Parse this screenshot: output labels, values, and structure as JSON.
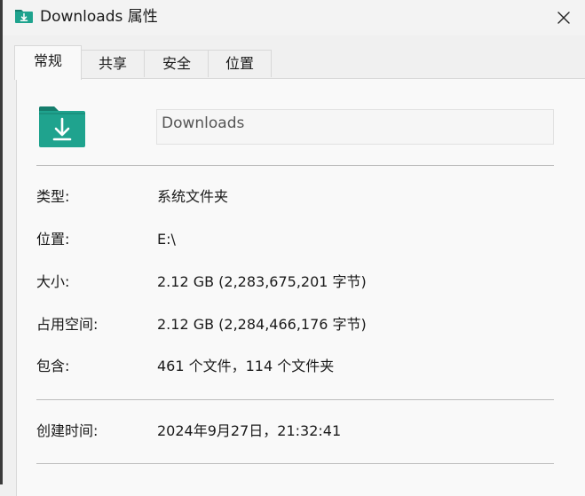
{
  "window": {
    "title": "Downloads 属性",
    "close_glyph": "✕"
  },
  "tabs": [
    {
      "label": "常规",
      "active": true
    },
    {
      "label": "共享",
      "active": false
    },
    {
      "label": "安全",
      "active": false
    },
    {
      "label": "位置",
      "active": false
    }
  ],
  "general": {
    "folder_name": "Downloads",
    "icon": "downloads-folder-icon",
    "rows": [
      {
        "label": "类型:",
        "value": "系统文件夹"
      },
      {
        "label": "位置:",
        "value": "E:\\"
      },
      {
        "label": "大小:",
        "value": "2.12 GB (2,283,675,201 字节)"
      },
      {
        "label": "占用空间:",
        "value": "2.12 GB (2,284,466,176 字节)"
      },
      {
        "label": "包含:",
        "value": "461 个文件，114 个文件夹"
      },
      {
        "label": "创建时间:",
        "value": "2024年9月27日，21:32:41"
      }
    ]
  },
  "colors": {
    "folder_teal": "#1fa38e",
    "folder_teal_dark": "#167e6d",
    "window_bg": "#f0f0f0",
    "panel_bg": "#f9f9f9"
  }
}
